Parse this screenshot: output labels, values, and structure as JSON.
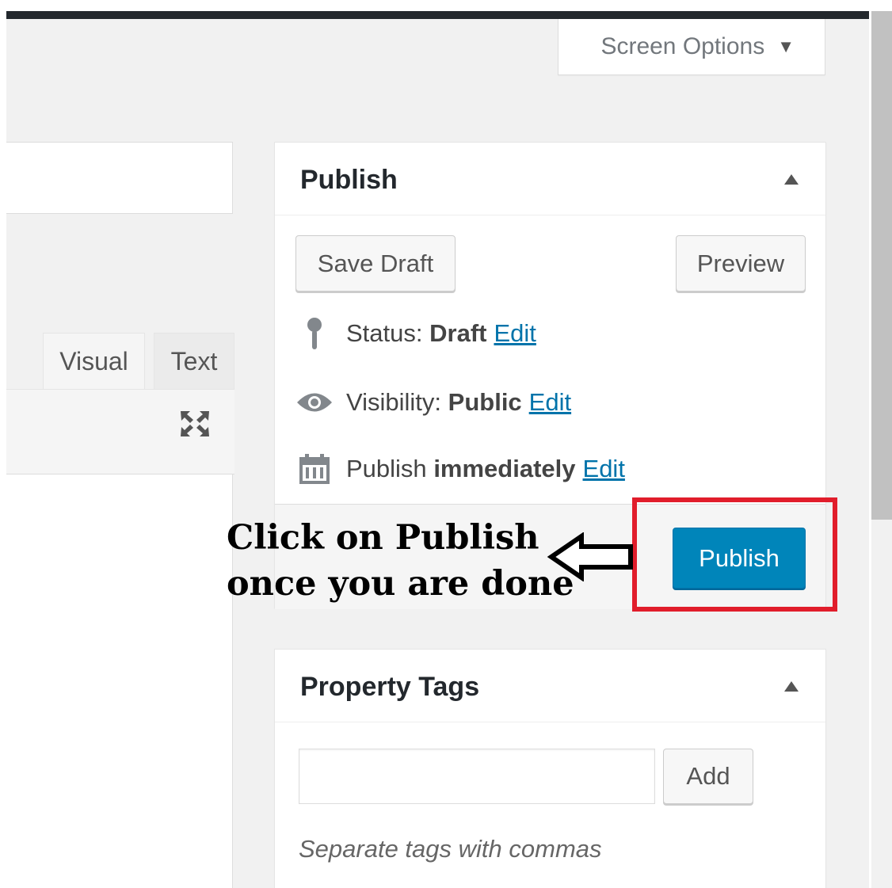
{
  "header": {
    "screen_options_label": "Screen Options",
    "screen_options_arrow": "▼"
  },
  "editor": {
    "tabs": [
      {
        "label": "Visual",
        "active": true
      },
      {
        "label": "Text",
        "active": false
      }
    ],
    "fullscreen_icon": "expand-icon"
  },
  "publish_box": {
    "title": "Publish",
    "save_draft_label": "Save Draft",
    "preview_label": "Preview",
    "status": {
      "label": "Status:",
      "value": "Draft",
      "edit": "Edit",
      "icon": "pin-icon"
    },
    "visibility": {
      "label": "Visibility:",
      "value": "Public",
      "edit": "Edit",
      "icon": "eye-icon"
    },
    "schedule": {
      "label": "Publish",
      "value": "immediately",
      "edit": "Edit",
      "icon": "calendar-icon"
    },
    "publish_label": "Publish",
    "publish_color": "#0085ba"
  },
  "annotation": {
    "line1": "Click on Publish",
    "line2": "once you are done",
    "highlight_color": "#e11d2b"
  },
  "tags_box": {
    "title": "Property Tags",
    "input_value": "",
    "add_label": "Add",
    "hint": "Separate tags with commas"
  }
}
